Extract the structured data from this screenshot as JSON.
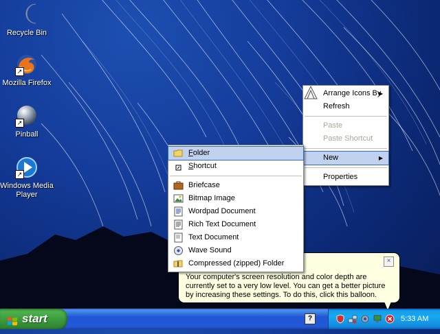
{
  "desktop": {
    "icons": [
      {
        "label": "Recycle Bin"
      },
      {
        "label": "Mozilla Firefox"
      },
      {
        "label": "Pinball"
      },
      {
        "label": "Windows Media Player"
      }
    ]
  },
  "context_menu": {
    "items": [
      {
        "label": "Arrange Icons By",
        "has_submenu": true
      },
      {
        "label": "Refresh"
      },
      {
        "label": "Paste",
        "disabled": true
      },
      {
        "label": "Paste Shortcut",
        "disabled": true
      },
      {
        "label": "New",
        "has_submenu": true,
        "selected": true
      },
      {
        "label": "Properties"
      }
    ]
  },
  "new_submenu": {
    "items": [
      {
        "label": "Folder",
        "underline": "F",
        "rest": "older",
        "selected": true
      },
      {
        "label": "Shortcut",
        "underline": "S",
        "rest": "hortcut"
      },
      {
        "label": "Briefcase"
      },
      {
        "label": "Bitmap Image"
      },
      {
        "label": "Wordpad Document"
      },
      {
        "label": "Rich Text Document"
      },
      {
        "label": "Text Document"
      },
      {
        "label": "Wave Sound"
      },
      {
        "label": "Compressed (zipped) Folder"
      }
    ]
  },
  "balloon": {
    "message_line1": "Your computer's screen resolution and color depth are",
    "message_line2": "currently set to a very low level. You can get a better picture",
    "message_line3": "by increasing these settings. To do this, click this balloon.",
    "close_glyph": "×"
  },
  "taskbar": {
    "start_label": "start",
    "help_glyph": "?",
    "clock": "5:33 AM"
  },
  "colors": {
    "menu_highlight": "#c1d2ee",
    "menu_highlight_border": "#316ac5",
    "balloon_bg": "#ffffe1",
    "taskbar_blue": "#2257d5",
    "start_green": "#3c9a3c"
  }
}
